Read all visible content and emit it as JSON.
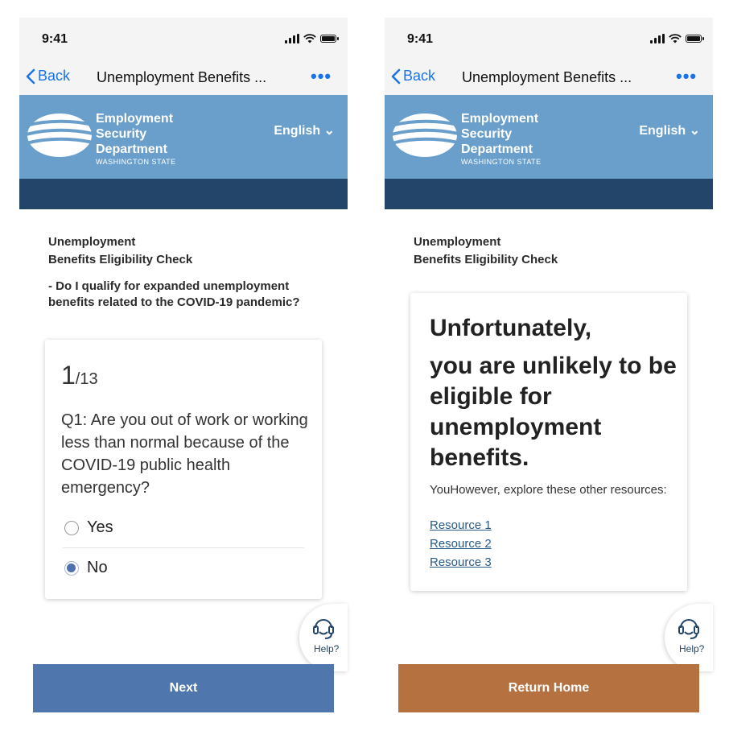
{
  "left": {
    "status": {
      "time": "9:41"
    },
    "nav": {
      "back_label": "Back",
      "title": "Unemployment Benefits ...",
      "more": "•••"
    },
    "header": {
      "logo_line1": "Employment",
      "logo_line2": "Security",
      "logo_line3": "Department",
      "logo_line4": "WASHINGTON STATE",
      "language": "English ⌄"
    },
    "page_title_line1": "Unemployment",
    "page_title_line2": "Benefits Eligibility Check",
    "subtitle": "- Do I qualify for expanded unemployment benefits related to the COVID-19 pandemic?",
    "question_card": {
      "progress_current": "1",
      "progress_total": "/13",
      "question": "Q1: Are you out of work or working less than normal because of the COVID-19 public health emergency?",
      "options": [
        {
          "label": "Yes",
          "selected": false
        },
        {
          "label": "No",
          "selected": true
        }
      ]
    },
    "help_label": "Help?",
    "button_label": "Next",
    "button_color": "#5077ad"
  },
  "right": {
    "status": {
      "time": "9:41"
    },
    "nav": {
      "back_label": "Back",
      "title": "Unemployment Benefits ...",
      "more": "•••"
    },
    "header": {
      "logo_line1": "Employment",
      "logo_line2": "Security",
      "logo_line3": "Department",
      "logo_line4": "WASHINGTON STATE",
      "language": "English ⌄"
    },
    "page_title_line1": "Unemployment",
    "page_title_line2": "Benefits Eligibility Check",
    "result_card": {
      "heading1": "Unfortunately,",
      "heading2": "you are unlikely to be eligible for unemployment benefits.",
      "body": "YouHowever, explore these other resources:",
      "links": [
        "Resource 1",
        "Resource 2",
        "Resource 3"
      ]
    },
    "help_label": "Help?",
    "button_label": "Return Home",
    "button_color": "#b57140"
  },
  "colors": {
    "header_blue": "#6a9fcb",
    "dark_band": "#234569",
    "link_blue": "#1a73e8"
  },
  "icons": [
    "chevron-left-icon",
    "signal-icon",
    "wifi-icon",
    "battery-icon",
    "headset-icon"
  ]
}
